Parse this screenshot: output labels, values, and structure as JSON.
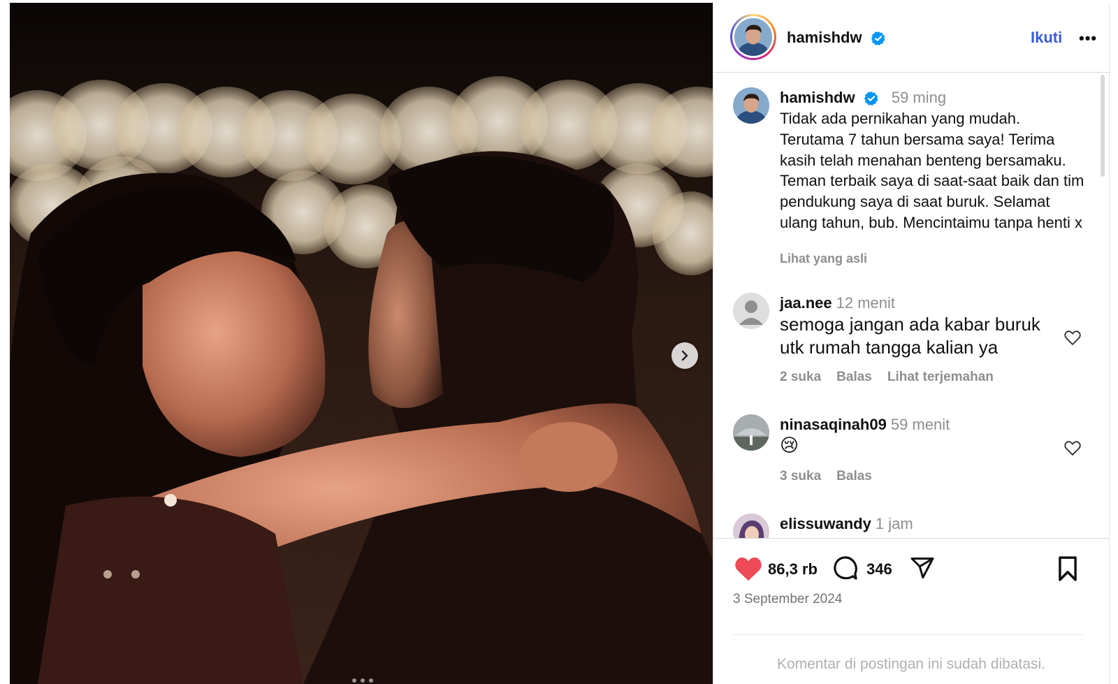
{
  "media": {
    "alt": "Foto pasangan berpelukan",
    "next_icon": "chevron-right-icon",
    "dot_count": 3
  },
  "header": {
    "username": "hamishdw",
    "verified_icon": "verified-badge-icon",
    "follow_label": "Ikuti",
    "more_label": "•••"
  },
  "caption": {
    "username": "hamishdw",
    "time": "59 ming",
    "text": "Tidak ada pernikahan yang mudah. Terutama 7 tahun bersama saya! Terima kasih telah menahan benteng bersamaku. Teman terbaik saya di saat-saat baik dan tim pendukung saya di saat buruk. Selamat ulang tahun, bub. Mencintaimu tanpa henti x",
    "see_original": "Lihat yang asli"
  },
  "comments": [
    {
      "username": "jaa.nee",
      "time": "12 menit",
      "text": "semoga jangan ada kabar buruk utk rumah tangga kalian ya",
      "likes": "2 suka",
      "reply": "Balas",
      "translate": "Lihat terjemahan"
    },
    {
      "username": "ninasaqinah09",
      "time": "59 menit",
      "text": "😢",
      "likes": "3 suka",
      "reply": "Balas"
    },
    {
      "username": "elissuwandy",
      "time": "1 jam"
    }
  ],
  "actions": {
    "like_count": "86,3 rb",
    "comment_count": "346",
    "date": "3 September 2024",
    "comments_limited": "Komentar di postingan ini sudah dibatasi."
  },
  "colors": {
    "like": "#ed4956",
    "follow": "#3a5bd9",
    "verified": "#0095f6",
    "muted": "#8e8e8e"
  }
}
